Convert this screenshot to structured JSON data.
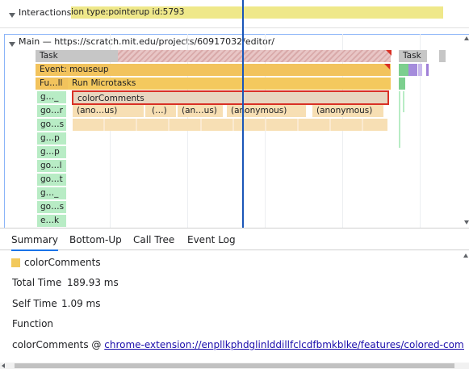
{
  "interactions": {
    "label": "Interactions",
    "event_label": "ion type:pointerup id:5793"
  },
  "main_thread": {
    "label": "Main — https://scratch.mit.edu/projects/60917032/editor/"
  },
  "flame": {
    "task_left": "Task",
    "task_right": "Task",
    "event": "Event: mouseup",
    "function_call": "Fu…ll",
    "run_microtasks": "Run Microtasks",
    "selected": "colorComments",
    "row4": [
      "(ano…us)",
      "(…)",
      "(an…us)",
      "(anonymous)",
      "(anonymous)"
    ],
    "side_labels": [
      "g…_",
      "go…r",
      "go…s",
      "g…p",
      "g…p",
      "go…l",
      "go…t",
      "g…_",
      "go…s",
      "e…k"
    ]
  },
  "tabs": [
    {
      "label": "Summary"
    },
    {
      "label": "Bottom-Up"
    },
    {
      "label": "Call Tree"
    },
    {
      "label": "Event Log"
    }
  ],
  "summary": {
    "title": "colorComments",
    "swatch_color": "#f2c95c",
    "total_time_label": "Total Time",
    "total_time_value": "189.93 ms",
    "self_time_label": "Self Time",
    "self_time_value": "1.09 ms",
    "function_label": "Function",
    "function_name": "colorComments @",
    "function_link": "chrome-extension://enpllkphdglinlddillfclcdfbmkblke/features/colored-comments.js"
  },
  "colors": {
    "task": "#c6c6c6",
    "event": "#f2c35d",
    "microtask": "#f4c95e",
    "js_light": "#f7dfb4",
    "selected": "#e8d6c0",
    "selected_border": "#d93025",
    "side": "#b8ecc5",
    "cursor_line": "#1a56b8"
  }
}
